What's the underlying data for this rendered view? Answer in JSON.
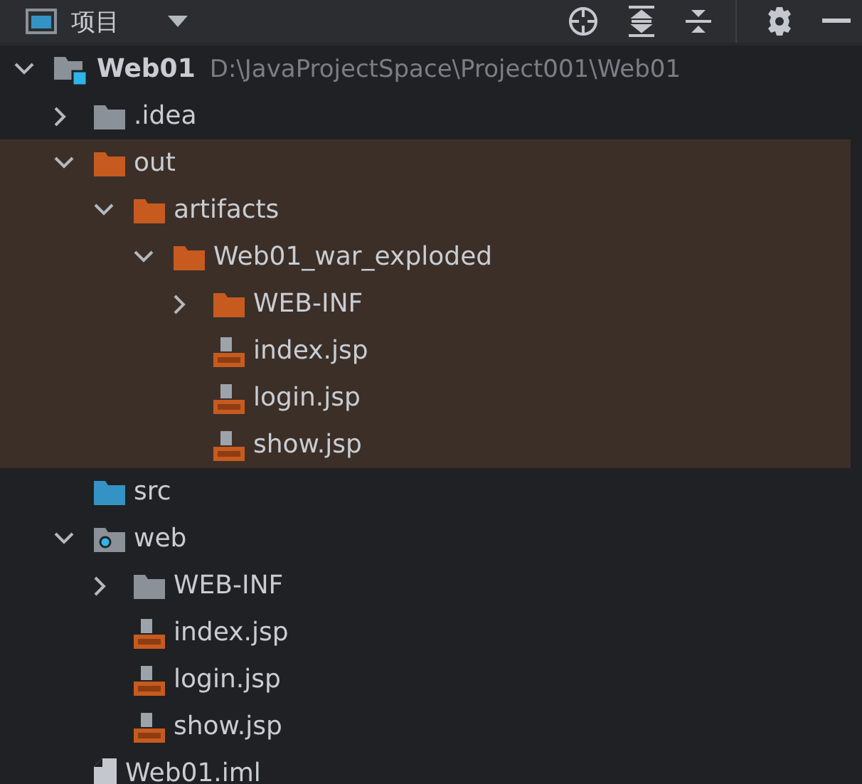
{
  "header": {
    "title": "项目"
  },
  "tree": [
    {
      "label": "Web01",
      "path": "D:\\JavaProjectSpace\\Project001\\Web01",
      "kind": "project",
      "expanded": true,
      "children": [
        {
          "label": ".idea",
          "kind": "folder",
          "expanded": false
        },
        {
          "label": "out",
          "kind": "folder",
          "excluded": true,
          "expanded": true,
          "children": [
            {
              "label": "artifacts",
              "kind": "folder",
              "expanded": true,
              "children": [
                {
                  "label": "Web01_war_exploded",
                  "kind": "folder",
                  "expanded": true,
                  "children": [
                    {
                      "label": "WEB-INF",
                      "kind": "folder",
                      "expanded": false
                    },
                    {
                      "label": "index.jsp",
                      "kind": "jsp"
                    },
                    {
                      "label": "login.jsp",
                      "kind": "jsp"
                    },
                    {
                      "label": "show.jsp",
                      "kind": "jsp"
                    }
                  ]
                }
              ]
            }
          ]
        },
        {
          "label": "src",
          "kind": "source-folder"
        },
        {
          "label": "web",
          "kind": "web-folder",
          "expanded": true,
          "children": [
            {
              "label": "WEB-INF",
              "kind": "folder",
              "expanded": false
            },
            {
              "label": "index.jsp",
              "kind": "jsp"
            },
            {
              "label": "login.jsp",
              "kind": "jsp"
            },
            {
              "label": "show.jsp",
              "kind": "jsp"
            }
          ]
        },
        {
          "label": "Web01.iml",
          "kind": "module-file"
        }
      ]
    }
  ]
}
